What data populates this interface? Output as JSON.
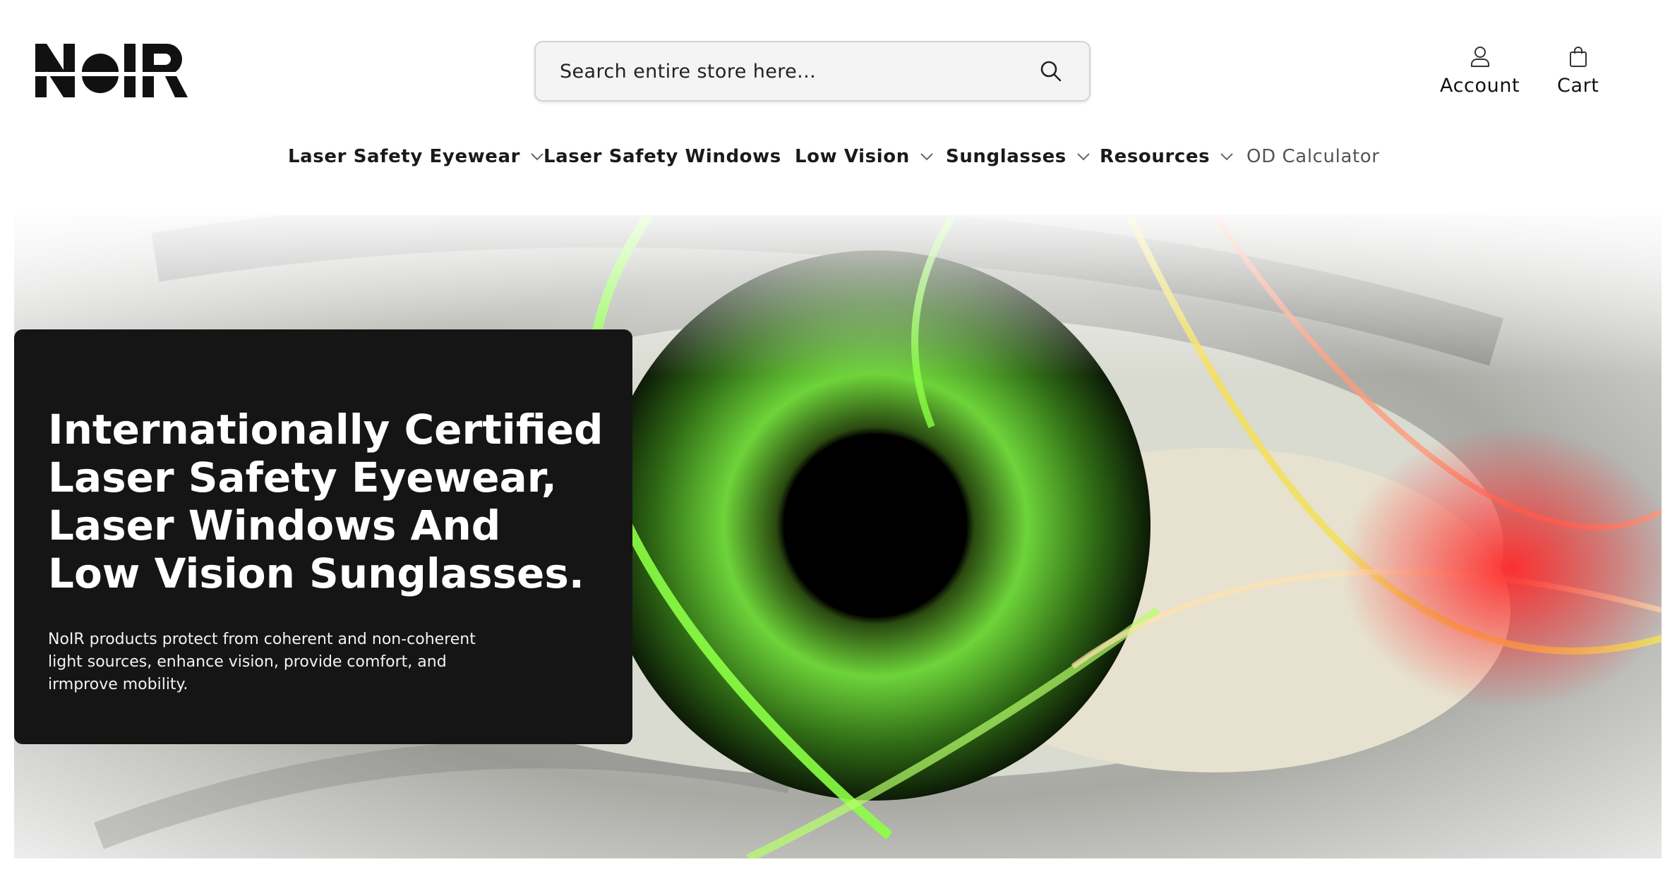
{
  "brand": {
    "logo_text": "NoIR"
  },
  "search": {
    "placeholder": "Search entire store here..."
  },
  "header_actions": {
    "account_label": "Account",
    "cart_label": "Cart"
  },
  "nav": {
    "items": [
      {
        "label": "Laser Safety Eyewear",
        "has_dropdown": true
      },
      {
        "label": "Laser Safety Windows",
        "has_dropdown": false
      },
      {
        "label": "Low Vision",
        "has_dropdown": true
      },
      {
        "label": "Sunglasses",
        "has_dropdown": true
      },
      {
        "label": "Resources",
        "has_dropdown": true
      },
      {
        "label": "OD Calculator",
        "has_dropdown": false
      }
    ]
  },
  "hero": {
    "title": "Internationally Certified Laser Safety Eyewear, Laser Windows And Low Vision Sunglasses.",
    "text": "NoIR products protect from coherent and non-coherent light sources, enhance vision, provide comfort, and irmprove mobility."
  },
  "colors": {
    "card_bg": "#151515",
    "laser_green": "#7cff3a",
    "laser_red": "#e0303a",
    "text": "#111111"
  }
}
